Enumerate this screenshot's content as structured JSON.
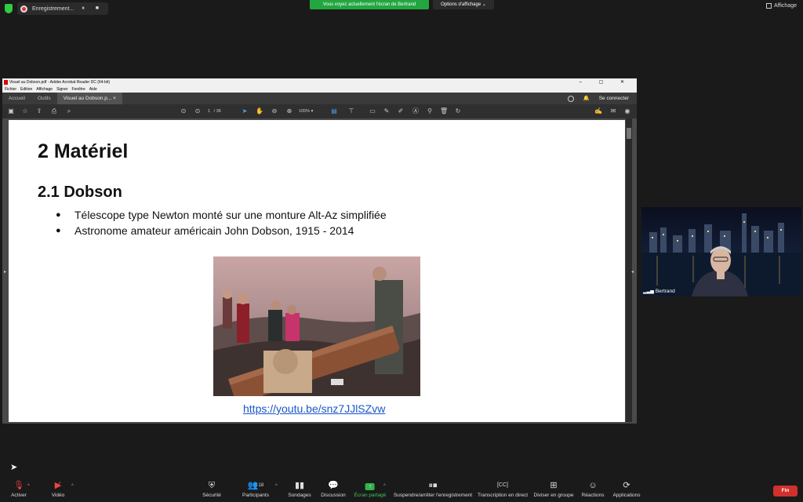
{
  "top": {
    "recording_label": "Enregistrement...",
    "recording_controls": "⏸ ■",
    "share_banner": "Vous voyez actuellement l'écran de Bertrand",
    "view_options": "Options d'affichage ⌄",
    "affichage": "Affichage"
  },
  "acrobat": {
    "title": "Visuel au Dobson.pdf - Adobe Acrobat Reader DC (64-bit)",
    "window_controls": "– ▢ ✕",
    "menu": [
      "Fichier",
      "Edition",
      "Affichage",
      "Signer",
      "Fenêtre",
      "Aide"
    ],
    "tabs": [
      "Accueil",
      "Outils",
      "Visuel au Dobson.p..."
    ],
    "tab_close": "×",
    "help_icon": "?",
    "signin": "Se connecter",
    "page_current": "1",
    "page_total": "/ 36",
    "zoom": "105%"
  },
  "document": {
    "h1": "2 Matériel",
    "h2": "2.1 Dobson",
    "bullets": [
      "Télescope type Newton monté sur une monture Alt-Az simplifiée",
      "Astronome amateur américain John Dobson, 1915 - 2014"
    ],
    "link": "https://youtu.be/snz7JJlSZvw"
  },
  "participant": {
    "name": "Bertrand"
  },
  "toolbar": {
    "items": [
      {
        "label": "Activer",
        "icon": "mic-muted-icon"
      },
      {
        "label": "Vidéo",
        "icon": "video-off-icon"
      },
      {
        "label": "Sécurité",
        "icon": "shield-icon"
      },
      {
        "label": "Participants",
        "icon": "participants-icon",
        "count": "18"
      },
      {
        "label": "Sondages",
        "icon": "polls-icon"
      },
      {
        "label": "Discussion",
        "icon": "chat-icon"
      },
      {
        "label": "Écran partagé",
        "icon": "share-screen-icon"
      },
      {
        "label": "Suspendre/arrêter l'enregistrement",
        "icon": "recording-icon"
      },
      {
        "label": "Transcription en direct",
        "icon": "cc-icon"
      },
      {
        "label": "Diviser en groupe",
        "icon": "breakout-icon"
      },
      {
        "label": "Réactions",
        "icon": "reactions-icon"
      },
      {
        "label": "Applications",
        "icon": "apps-icon"
      }
    ],
    "end": "Fin"
  }
}
